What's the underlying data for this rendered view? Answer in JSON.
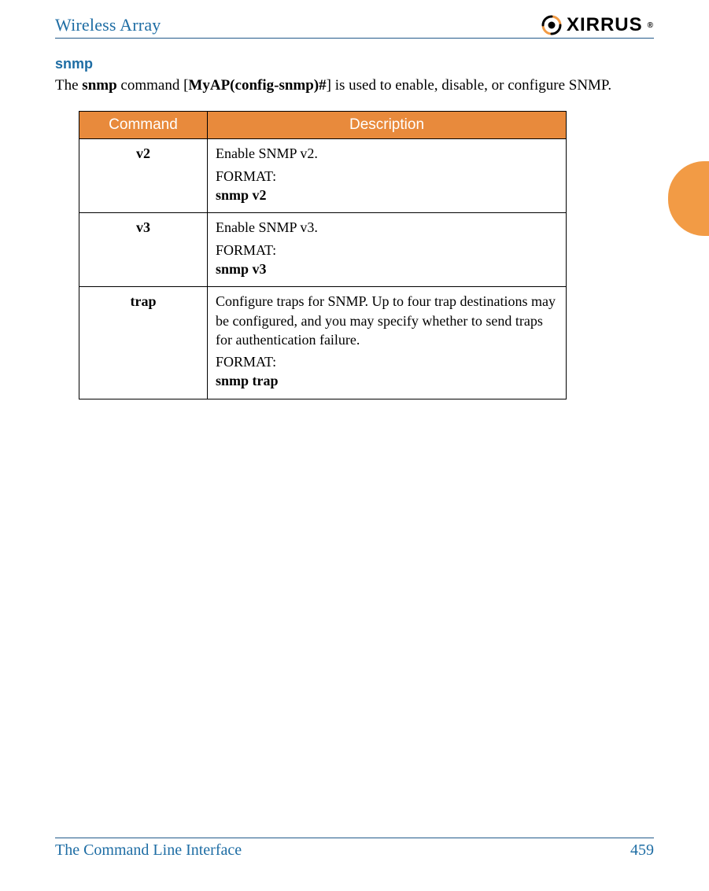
{
  "header": {
    "title": "Wireless Array",
    "brand_text": "XIRRUS"
  },
  "section": {
    "heading": "snmp",
    "intro_prefix": "The ",
    "intro_bold1": "snmp",
    "intro_mid": " command [",
    "intro_bold2": "MyAP(config-snmp)#",
    "intro_suffix": "] is used to enable, disable, or configure SNMP."
  },
  "table": {
    "headers": {
      "col1": "Command",
      "col2": "Description"
    },
    "rows": [
      {
        "cmd": "v2",
        "desc": "Enable SNMP v2.",
        "format_label": "FORMAT:",
        "format_value": "snmp v2"
      },
      {
        "cmd": "v3",
        "desc": "Enable SNMP v3.",
        "format_label": "FORMAT:",
        "format_value": "snmp v3"
      },
      {
        "cmd": "trap",
        "desc": "Configure traps for SNMP. Up to four trap destinations may be configured, and you may specify whether to send traps for authentication failure.",
        "format_label": "FORMAT:",
        "format_value": "snmp trap"
      }
    ]
  },
  "footer": {
    "left": "The Command Line Interface",
    "right": "459"
  }
}
